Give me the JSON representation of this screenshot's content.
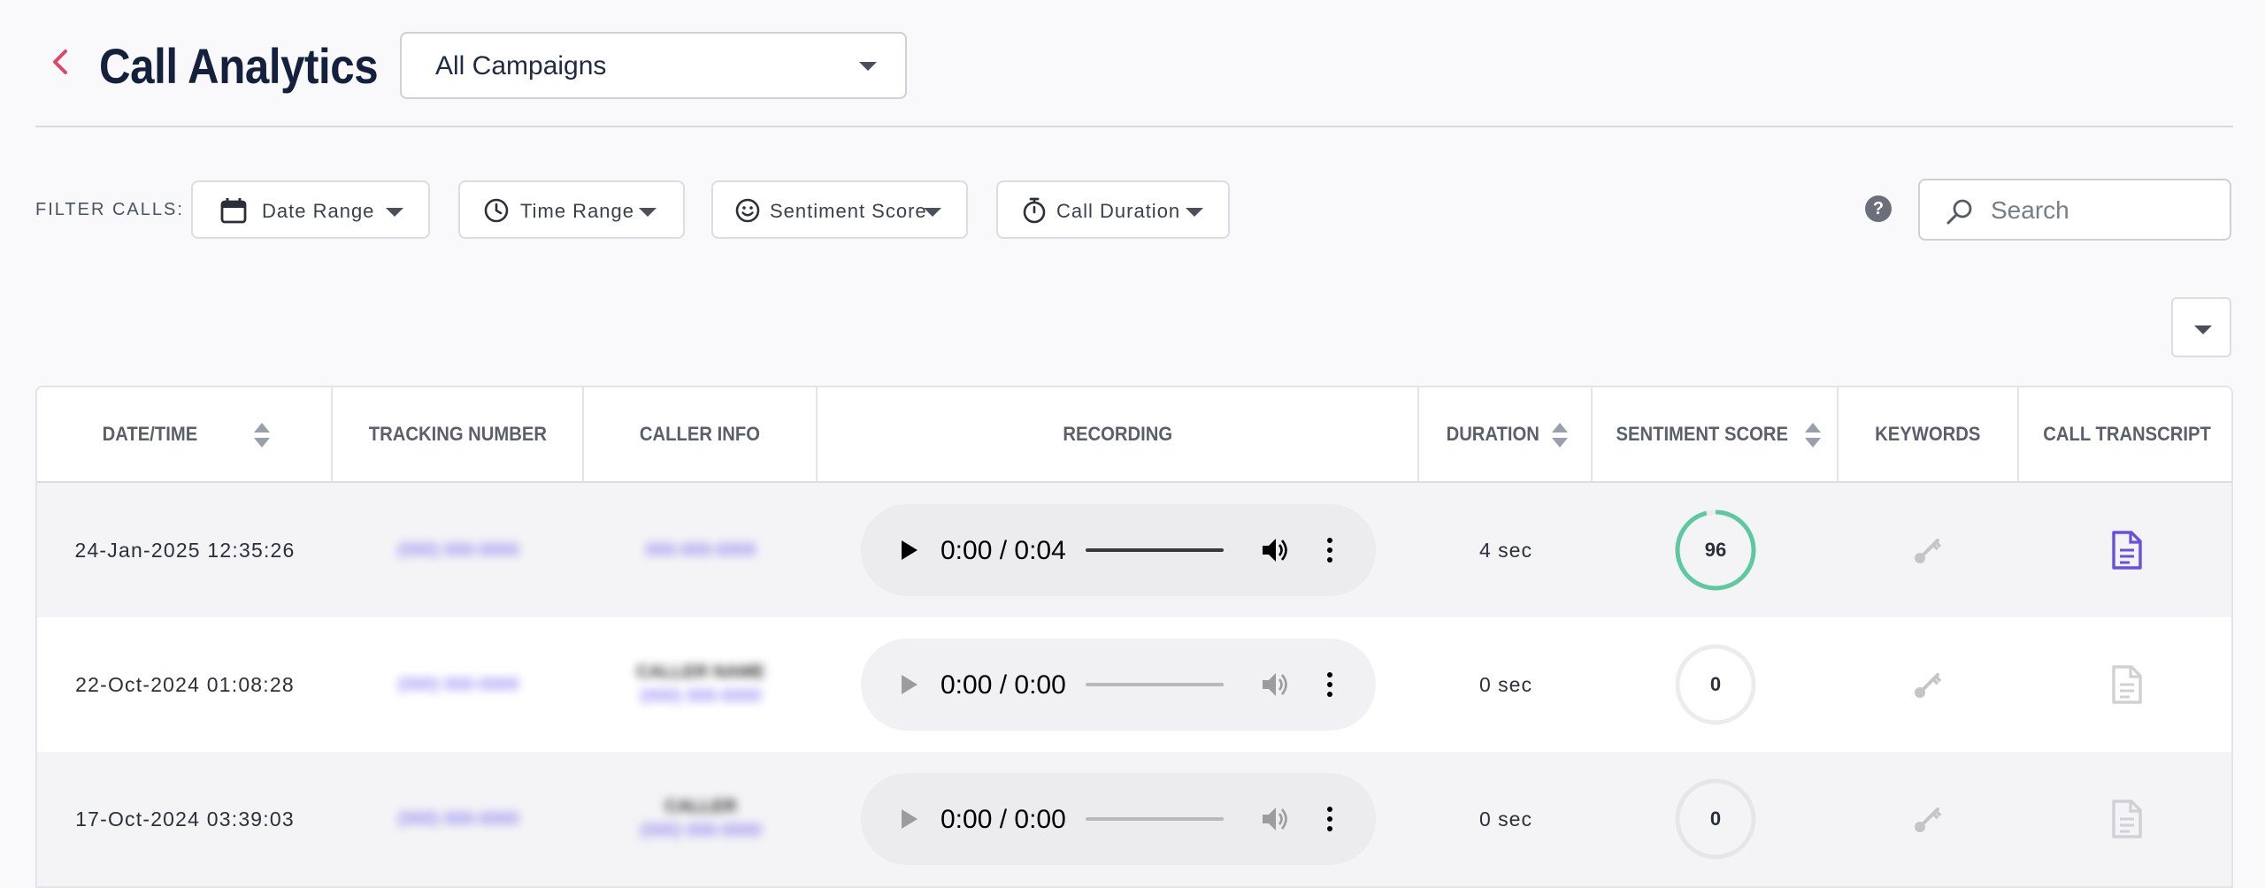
{
  "header": {
    "title": "Call Analytics",
    "campaign_selected": "All Campaigns"
  },
  "filters": {
    "label": "FILTER CALLS:",
    "date_range": "Date Range",
    "time_range": "Time Range",
    "sentiment_score": "Sentiment Score",
    "call_duration": "Call Duration"
  },
  "search": {
    "placeholder": "Search"
  },
  "help": {
    "label": "?"
  },
  "table": {
    "columns": {
      "datetime": "DATE/TIME",
      "tracking_number": "TRACKING NUMBER",
      "caller_info": "CALLER INFO",
      "recording": "RECORDING",
      "duration": "DURATION",
      "sentiment_score": "SENTIMENT SCORE",
      "keywords": "KEYWORDS",
      "call_transcript": "CALL TRANSCRIPT"
    },
    "rows": [
      {
        "datetime": "24-Jan-2025 12:35:26",
        "tracking": "(000) 000-0000",
        "caller_name": "",
        "caller_number": "000-000-0000",
        "recording_time": "0:00 / 0:04",
        "duration": "4 sec",
        "sentiment": "96",
        "sentiment_fraction": 0.96,
        "transcript_available": true
      },
      {
        "datetime": "22-Oct-2024 01:08:28",
        "tracking": "(000) 000-0000",
        "caller_name": "CALLER NAME",
        "caller_number": "(000) 000-0000",
        "recording_time": "0:00 / 0:00",
        "duration": "0 sec",
        "sentiment": "0",
        "sentiment_fraction": 0,
        "transcript_available": false
      },
      {
        "datetime": "17-Oct-2024 03:39:03",
        "tracking": "(000) 000-0000",
        "caller_name": "CALLER",
        "caller_number": "(000) 000-0000",
        "recording_time": "0:00 / 0:00",
        "duration": "0 sec",
        "sentiment": "0",
        "sentiment_fraction": 0,
        "transcript_available": false
      }
    ]
  },
  "colors": {
    "accent_back": "#e0456a",
    "title": "#14213d",
    "sentiment_ring": "#5cc9a0",
    "transcript_active": "#6a4fe0",
    "link_blur": "#6b5cf0"
  }
}
